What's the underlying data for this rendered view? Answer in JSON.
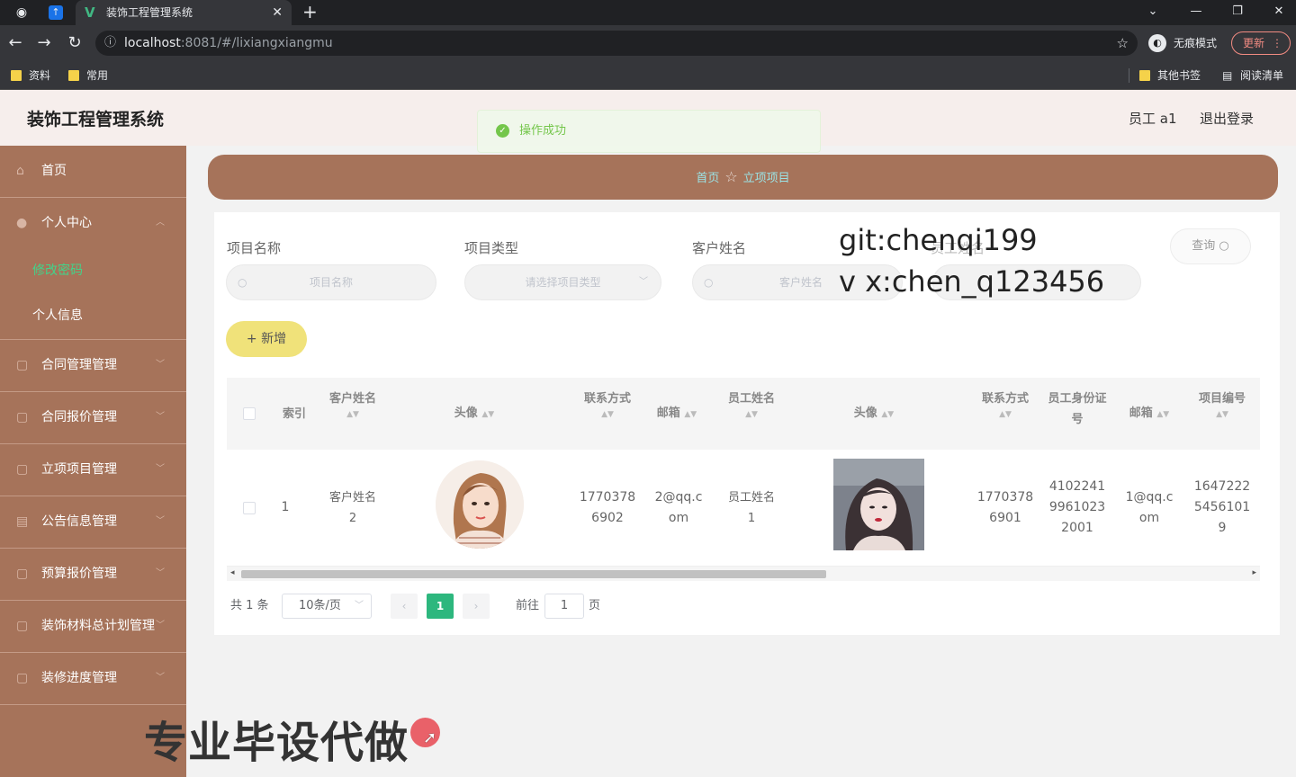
{
  "browser": {
    "tab_title": "装饰工程管理系统",
    "url_host": "localhost",
    "url_path": ":8081/#/lixiangxiangmu",
    "incognito_label": "无痕模式",
    "update_label": "更新",
    "bookmarks": [
      "资料",
      "常用"
    ],
    "other_bookmarks": "其他书签",
    "reading_list": "阅读清单"
  },
  "header": {
    "app_title": "装饰工程管理系统",
    "user_label": "员工 a1",
    "logout_label": "退出登录"
  },
  "toast": {
    "message": "操作成功"
  },
  "sidebar": {
    "home": "首页",
    "personal_center": "个人中心",
    "sub_change_password": "修改密码",
    "sub_personal_info": "个人信息",
    "items": [
      "合同管理管理",
      "合同报价管理",
      "立项项目管理",
      "公告信息管理",
      "预算报价管理",
      "装饰材料总计划管理",
      "装修进度管理"
    ]
  },
  "breadcrumb": {
    "home": "首页",
    "current": "立项项目"
  },
  "filters": {
    "project_name_label": "项目名称",
    "project_name_placeholder": "项目名称",
    "project_type_label": "项目类型",
    "project_type_placeholder": "请选择项目类型",
    "customer_name_label": "客户姓名",
    "customer_name_placeholder": "客户姓名",
    "employee_name_label": "员工姓名",
    "query_label": "查询",
    "add_label": "新增"
  },
  "watermark": {
    "line1": "git:chenqi199",
    "line2": "v x:chen_q123456"
  },
  "table": {
    "headers": [
      "索引",
      "客户姓名",
      "头像",
      "联系方式",
      "邮箱",
      "员工姓名",
      "头像",
      "联系方式",
      "员工身份证号",
      "邮箱",
      "项目编号"
    ],
    "rows": [
      {
        "index": "1",
        "customer_name": [
          "客户姓名",
          "2"
        ],
        "customer_phone": [
          "1770378",
          "6902"
        ],
        "customer_email": [
          "2@qq.c",
          "om"
        ],
        "employee_name": [
          "员工姓名",
          "1"
        ],
        "employee_phone": [
          "1770378",
          "6901"
        ],
        "employee_id": [
          "4102241",
          "9961023",
          "2001"
        ],
        "employee_email": [
          "1@qq.c",
          "om"
        ],
        "project_no": [
          "1647222",
          "5456101",
          "9"
        ]
      }
    ]
  },
  "pagination": {
    "total": "共 1 条",
    "page_size": "10条/页",
    "current_page": "1",
    "goto_label": "前往",
    "goto_value": "1",
    "page_unit": "页"
  },
  "promo_text": "专业毕设代做",
  "colors": {
    "sidebar": "#a6735a",
    "accent_green": "#2db77e",
    "add_button": "#f0e27a",
    "header_bg": "#f6eeec"
  }
}
